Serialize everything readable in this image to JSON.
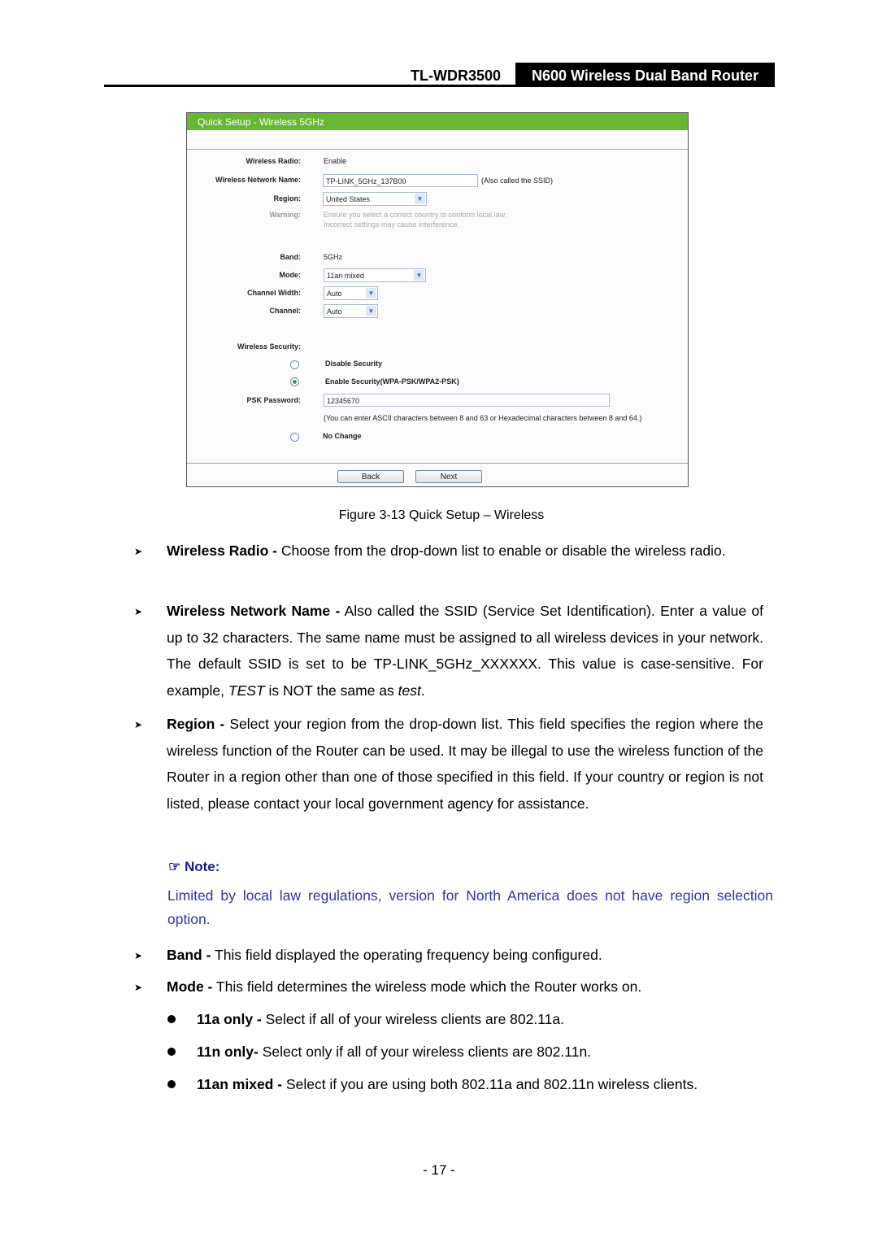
{
  "header": {
    "model": "TL-WDR3500",
    "product": "N600 Wireless Dual Band Router"
  },
  "screenshot": {
    "title": "Quick Setup - Wireless 5GHz",
    "fields": {
      "wireless_radio": {
        "label": "Wireless Radio:",
        "value": "Enable"
      },
      "network_name": {
        "label": "Wireless Network Name:",
        "value": "TP-LINK_5GHz_137B00",
        "note": "(Also called the SSID)"
      },
      "region": {
        "label": "Region:",
        "value": "United States"
      },
      "warning": {
        "label": "Warning:",
        "line1": "Ensure you select a correct country to conform local law.",
        "line2": "Incorrect settings may cause interference."
      },
      "band": {
        "label": "Band:",
        "value": "5GHz"
      },
      "mode": {
        "label": "Mode:",
        "value": "11an mixed"
      },
      "channel_width": {
        "label": "Channel Width:",
        "value": "Auto"
      },
      "channel": {
        "label": "Channel:",
        "value": "Auto"
      },
      "security": {
        "label": "Wireless Security:"
      },
      "disable_security": {
        "label": "Disable Security",
        "selected": false
      },
      "enable_security": {
        "label": "Enable Security(WPA-PSK/WPA2-PSK)",
        "selected": true
      },
      "psk_password": {
        "label": "PSK Password:",
        "value": "12345670",
        "hint": "(You can enter ASCII characters between 8 and 63 or Hexadecimal characters between 8 and 64.)"
      },
      "no_change": {
        "label": "No Change",
        "selected": false
      }
    },
    "buttons": {
      "back": "Back",
      "next": "Next"
    }
  },
  "caption": "Figure 3-13 Quick Setup – Wireless",
  "items": {
    "wireless_radio": {
      "term": "Wireless Radio -",
      "text": " Choose from the drop-down list to enable or disable the wireless radio."
    },
    "network_name": {
      "term": "Wireless Network Name -",
      "text1": " Also called the SSID (Service Set Identification). Enter a value of up to 32 characters. The same name must be assigned to all wireless devices in your network. The default SSID is set to be TP-LINK_5GHz_XXXXXX. This value is case-sensitive. For example, ",
      "em1": "TEST",
      "text2": " is NOT the same as ",
      "em2": "test",
      "text3": "."
    },
    "region": {
      "term": "Region -",
      "text": " Select your region from the drop-down list. This field specifies the region where the wireless function of the Router can be used. It may be illegal to use the wireless function of the Router in a region other than one of those specified in this field. If your country or region is not listed, please contact your local government agency for assistance."
    },
    "band": {
      "term": "Band -",
      "text": " This field displayed the operating frequency being configured."
    },
    "mode": {
      "term": "Mode -",
      "text": " This field determines the wireless mode which the Router works on."
    }
  },
  "note": {
    "heading": "Note:",
    "icon": "pointing-hand-icon",
    "text": "Limited by local law regulations, version for North America does not have region selection option."
  },
  "modes": [
    {
      "term": "11a only -",
      "text": " Select if all of your wireless clients are 802.11a."
    },
    {
      "term": "11n only-",
      "text": " Select only if all of your wireless clients are 802.11n."
    },
    {
      "term": "11an mixed -",
      "text": " Select if you are using both 802.11a and 802.11n wireless clients."
    }
  ],
  "page_number": "- 17 -"
}
